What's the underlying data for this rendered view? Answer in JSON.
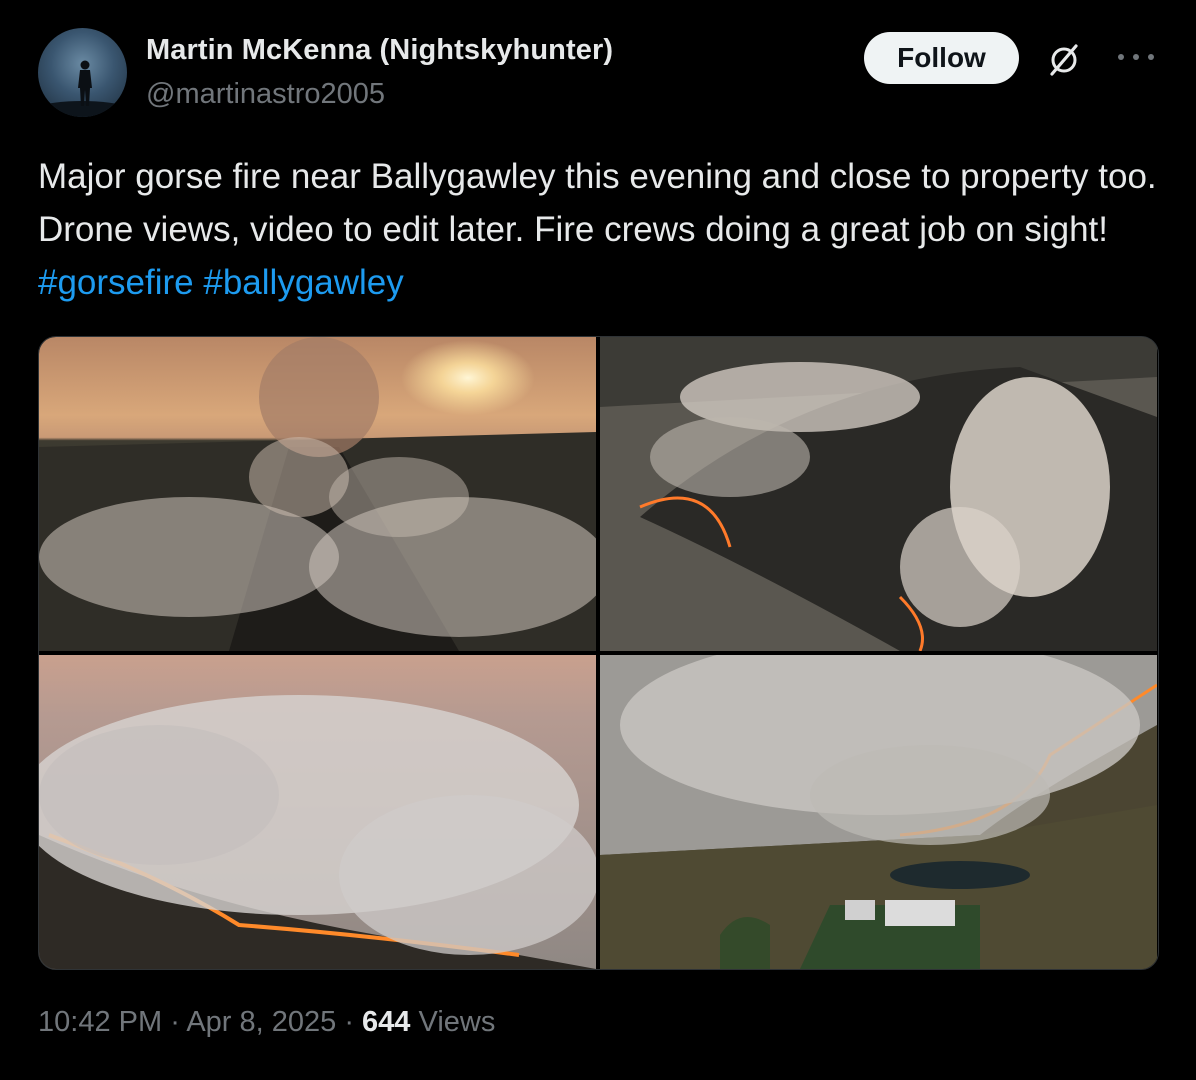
{
  "author": {
    "display_name": "Martin McKenna (Nightskyhunter)",
    "handle": "@martinastro2005",
    "avatar_icon": "person-silhouette-avatar"
  },
  "actions": {
    "follow_label": "Follow",
    "grok_icon": "grok-icon",
    "more_icon": "more-dots-icon"
  },
  "tweet": {
    "text": "Major gorse fire near Ballygawley this evening and close to property too. Drone views, video to edit later. Fire crews doing a great job on sight! ",
    "hashtags": [
      "#gorsefire",
      "#ballygawley"
    ],
    "hashtag_color": "#1d9bf0"
  },
  "media": [
    {
      "subject": "drone view of smoke trail toward setting sun"
    },
    {
      "subject": "aerial view of burning hillside with smoke plumes"
    },
    {
      "subject": "fire line with dense smoke across moorland"
    },
    {
      "subject": "fire near house and pond"
    }
  ],
  "meta": {
    "time": "10:42 PM",
    "separator": " · ",
    "date": "Apr 8, 2025",
    "views_count": "644",
    "views_label": " Views"
  }
}
